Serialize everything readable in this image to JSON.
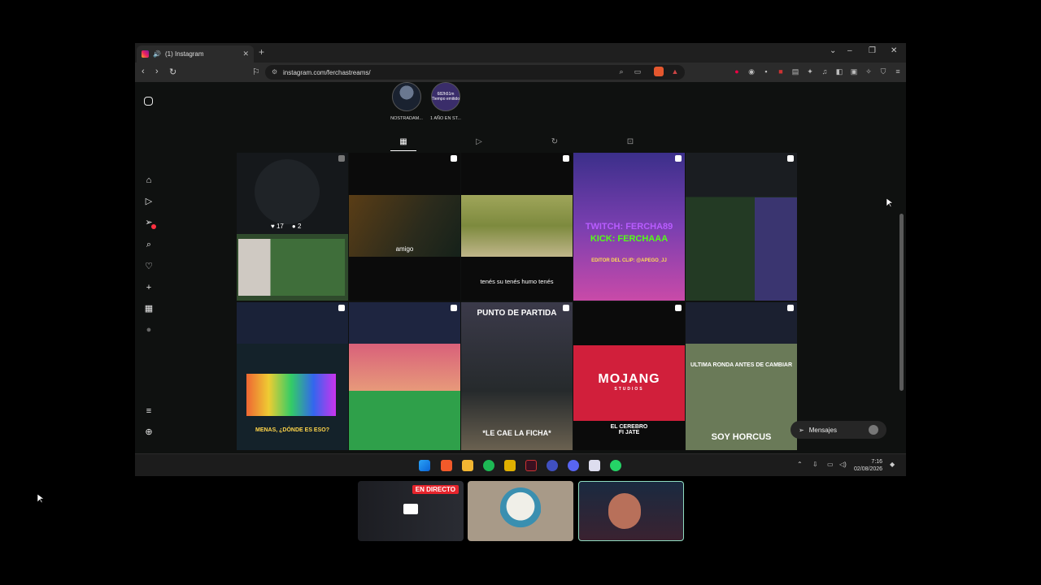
{
  "browser": {
    "tab_title": "(1) Instagram",
    "url": "instagram.com/ferchastreams/"
  },
  "highlights": [
    {
      "label": "NOSTRADAM...",
      "ring_text": ""
    },
    {
      "label": "1 AÑO EN ST...",
      "ring_text": "682h51m Tiempo emitido"
    }
  ],
  "posts": {
    "first": {
      "likes": "17",
      "comments": "2"
    },
    "captions": {
      "amigo": "amigo",
      "humo": "tenés su tenés humo tenés",
      "twitch": "TWITCH: FERCHA89",
      "kick": "KICK: FERCHAAA",
      "editor": "EDITOR DEL CLIP: @APEGO_JJ",
      "donde": "MENAS, ¿DÓNDE ES ESO?",
      "partida": "PUNTO DE PARTIDA",
      "ficha": "*LE CAE LA FICHA*",
      "mojang": "MOJANG",
      "studios": "STUDIOS",
      "cerebro": "EL CEREBRO FI JATE",
      "ronda": "ULTIMA RONDA ANTES DE CAMBIAR",
      "horcus": "SOY HORCUS"
    }
  },
  "messages": {
    "label": "Mensajes"
  },
  "taskbar": {
    "time": "7:16",
    "date": "02/08/2026"
  },
  "stream": {
    "live_label": "EN DIRECTO"
  }
}
